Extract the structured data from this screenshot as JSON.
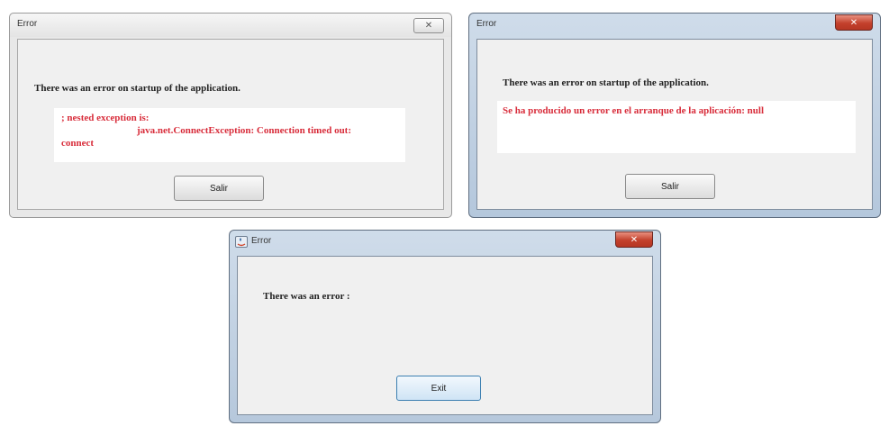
{
  "windows": [
    {
      "title": "Error",
      "close_glyph": "✕",
      "message": "There was an error on startup of the application.",
      "detail_line1": "; nested exception is:",
      "detail_line2": "java.net.ConnectException: Connection timed out:",
      "detail_line3": "connect",
      "button_label": "Salir"
    },
    {
      "title": "Error",
      "close_glyph": "✕",
      "message": "There was an error on startup of the application.",
      "detail_line1": "Se ha producido un error en el arranque de la aplicación: null",
      "button_label": "Salir"
    },
    {
      "title": "Error",
      "close_glyph": "✕",
      "message": "There was an error :",
      "button_label": "Exit"
    }
  ],
  "colors": {
    "error_text": "#d82c3a",
    "close_button_red": "#c3402c",
    "dialog_background": "#f0f0f0"
  }
}
